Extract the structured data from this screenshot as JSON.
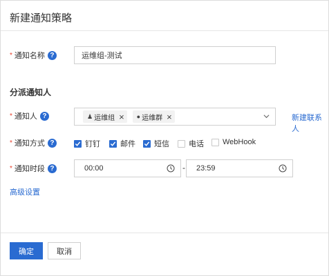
{
  "dialog": {
    "title": "新建通知策略"
  },
  "name_field": {
    "label": "通知名称",
    "value": "运维组-测试"
  },
  "section": {
    "title": "分派通知人"
  },
  "recipients": {
    "label": "通知人",
    "tags": [
      {
        "label": "运维组",
        "icon": "user-group-icon"
      },
      {
        "label": "运维群",
        "icon": "chat-group-icon"
      }
    ],
    "new_contact_link": "新建联系人"
  },
  "methods": {
    "label": "通知方式",
    "options": [
      {
        "label": "钉钉",
        "checked": true
      },
      {
        "label": "邮件",
        "checked": true
      },
      {
        "label": "短信",
        "checked": true
      },
      {
        "label": "电话",
        "checked": false
      },
      {
        "label": "WebHook",
        "checked": false
      }
    ]
  },
  "period": {
    "label": "通知时段",
    "start": "00:00",
    "separator": "-",
    "end": "23:59"
  },
  "advanced_link": "高级设置",
  "buttons": {
    "confirm": "确定",
    "cancel": "取消"
  },
  "colors": {
    "primary": "#2a6bd1",
    "required": "#e8412d"
  }
}
